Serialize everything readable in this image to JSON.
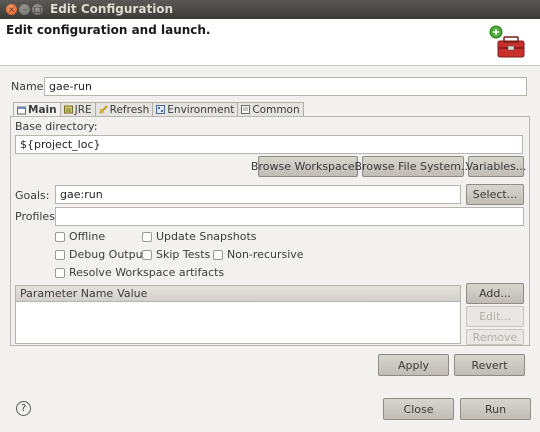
{
  "window": {
    "title": "Edit Configuration"
  },
  "header": {
    "title": "Edit configuration and launch."
  },
  "name": {
    "label": "Name:",
    "value": "gae-run"
  },
  "tabs": [
    {
      "label": "Main",
      "icon": "main-tab-icon"
    },
    {
      "label": "JRE",
      "icon": "jre-tab-icon"
    },
    {
      "label": "Refresh",
      "icon": "refresh-tab-icon"
    },
    {
      "label": "Environment",
      "icon": "environment-tab-icon"
    },
    {
      "label": "Common",
      "icon": "common-tab-icon"
    }
  ],
  "base_dir": {
    "label": "Base directory:",
    "value": "${project_loc}"
  },
  "browse": {
    "workspace": "Browse Workspace...",
    "filesystem": "Browse File System...",
    "variables": "Variables..."
  },
  "goals": {
    "label": "Goals:",
    "value": "gae:run",
    "select": "Select..."
  },
  "profiles": {
    "label": "Profiles:",
    "value": ""
  },
  "options": {
    "offline": "Offline",
    "update_snapshots": "Update Snapshots",
    "debug_output": "Debug Output",
    "skip_tests": "Skip Tests",
    "non_recursive": "Non-recursive",
    "resolve_workspace": "Resolve Workspace artifacts"
  },
  "params": {
    "col_name": "Parameter Name",
    "col_value": "Value",
    "add": "Add...",
    "edit": "Edit...",
    "remove": "Remove"
  },
  "actions": {
    "apply": "Apply",
    "revert": "Revert",
    "close": "Close",
    "run": "Run"
  },
  "help": {
    "glyph": "?"
  }
}
